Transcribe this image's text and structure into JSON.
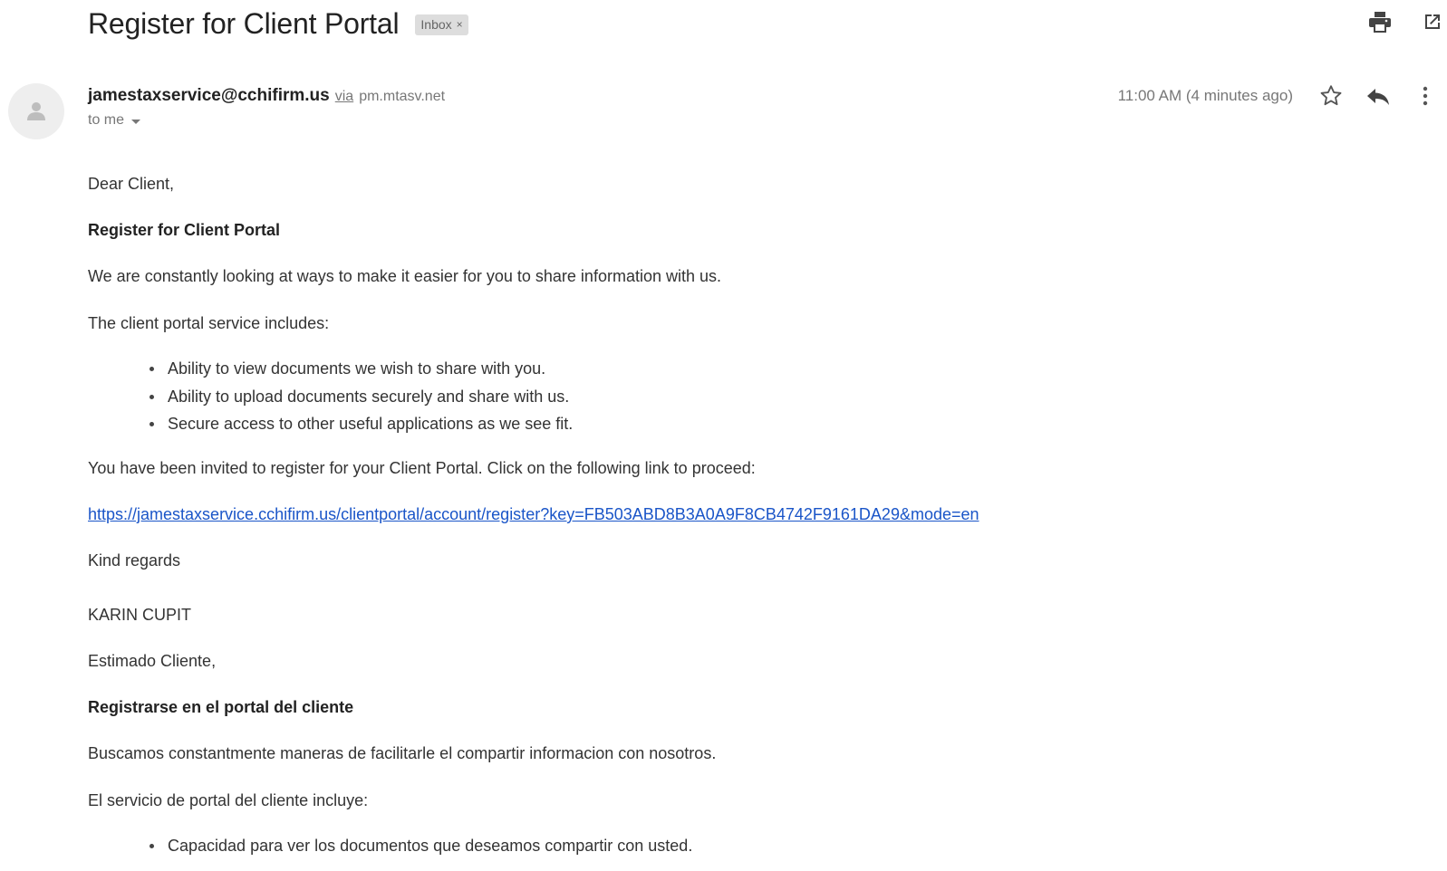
{
  "email": {
    "subject": "Register for Client Portal",
    "label": "Inbox",
    "label_remove": "×",
    "sender_email": "jamestaxservice@cchifirm.us",
    "via_text": "via",
    "via_host": "pm.mtasv.net",
    "recipient_text": "to me",
    "timestamp": "11:00 AM (4 minutes ago)"
  },
  "icons": {
    "print": "print-icon",
    "open_new_window": "open-in-new-window-icon",
    "avatar": "person-avatar-icon",
    "star": "star-icon",
    "reply": "reply-icon",
    "more": "more-vert-icon",
    "recipient_caret": "chevron-down-icon"
  },
  "body": {
    "greeting_en": "Dear Client,",
    "heading_en": "Register for Client Portal",
    "intro_en": "We are constantly looking at ways to make it easier for you to share information with us.",
    "includes_en": "The client portal service includes:",
    "bullets_en": [
      "Ability to view documents we wish to share with you.",
      "Ability to upload documents securely and share with us.",
      "Secure access to other useful applications as we see fit."
    ],
    "invite_en": "You have been invited to register for your Client Portal. Click on the following link to proceed:",
    "link": "https://jamestaxservice.cchifirm.us/clientportal/account/register?key=FB503ABD8B3A0A9F8CB4742F9161DA29&mode=en",
    "regards": "Kind regards",
    "signature": "KARIN CUPIT",
    "greeting_es": "Estimado Cliente,",
    "heading_es": "Registrarse en el portal del cliente",
    "intro_es": "Buscamos constantmente maneras de facilitarle el compartir informacion con nosotros.",
    "includes_es": "El servicio de portal del cliente incluye:",
    "bullets_es": [
      "Capacidad para ver los documentos que deseamos compartir con usted."
    ]
  },
  "colors": {
    "link": "#1a55c8",
    "label_chip_bg": "#dddddd",
    "muted_text": "#777777"
  }
}
